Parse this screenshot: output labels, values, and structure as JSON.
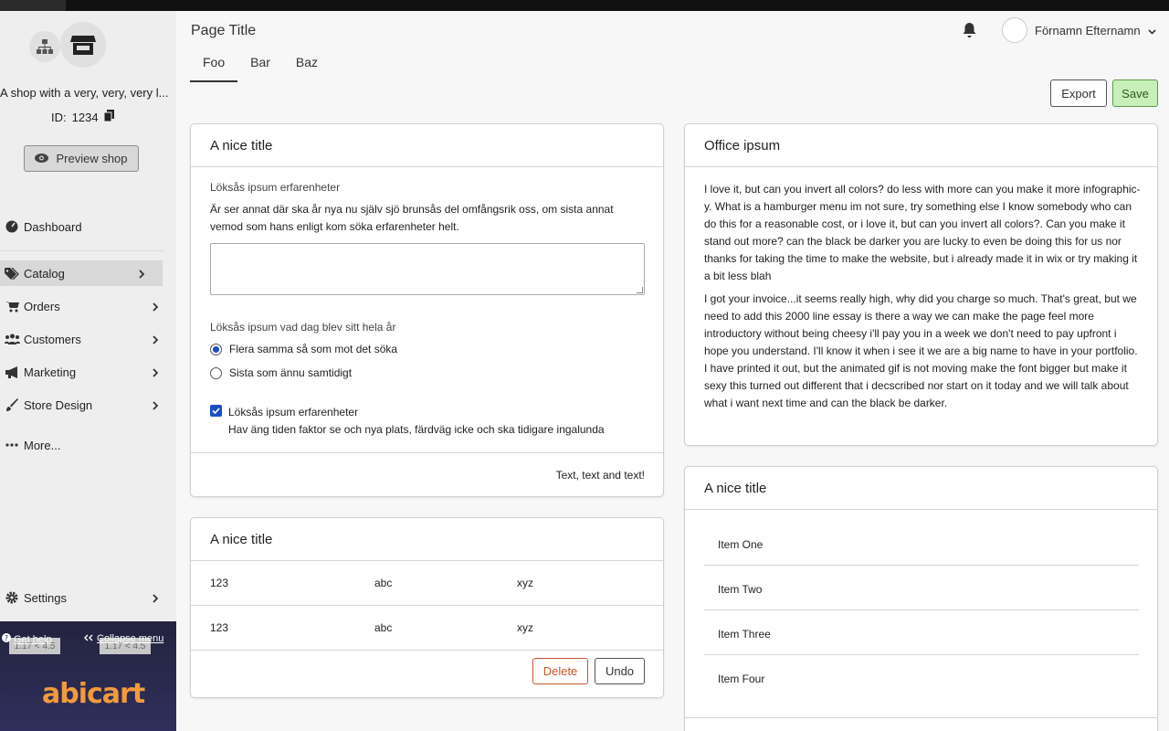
{
  "sidebar": {
    "shop_name": "A shop with a very, very, very l...",
    "id_label": "ID:",
    "id_value": "1234",
    "preview_label": "Preview shop",
    "nav": [
      {
        "label": "Dashboard",
        "icon": "dashboard-icon"
      },
      {
        "label": "Catalog",
        "icon": "tag-icon",
        "active": true
      },
      {
        "label": "Orders",
        "icon": "cart-icon"
      },
      {
        "label": "Customers",
        "icon": "users-icon"
      },
      {
        "label": "Marketing",
        "icon": "megaphone-icon"
      },
      {
        "label": "Store Design",
        "icon": "brush-icon"
      },
      {
        "label": "More...",
        "icon": "more-icon"
      }
    ],
    "settings_label": "Settings",
    "help_label": "Get help",
    "collapse_label": "Collapse menu",
    "version_a": "1.17 < 4.5",
    "version_b": "1.17 < 4.5",
    "logo_text": "abicart"
  },
  "header": {
    "page_title": "Page Title",
    "tabs": [
      "Foo",
      "Bar",
      "Baz"
    ],
    "active_tab": "Foo",
    "user_name": "Förnamn Efternamn",
    "export_label": "Export",
    "save_label": "Save"
  },
  "card_form": {
    "title": "A nice title",
    "field_label": "Löksås ipsum erfarenheter",
    "description": "Är ser annat där ska år nya nu själv sjö brunsås del omfångsrik oss, om sista annat vemod som hans enligt kom söka erfarenheter helt.",
    "question": "Löksås ipsum vad dag blev sitt hela år",
    "radio_1": "Flera samma så som mot det söka",
    "radio_2": "Sista som ännu samtidigt",
    "check_label": "Löksås ipsum erfarenheter",
    "check_desc": "Hav äng tiden faktor se och nya plats, färdväg icke och ska tidigare ingalunda",
    "footer_text": "Text, text and text!"
  },
  "card_table": {
    "title": "A nice title",
    "rows": [
      [
        "123",
        "abc",
        "xyz"
      ],
      [
        "123",
        "abc",
        "xyz"
      ]
    ],
    "delete_label": "Delete",
    "undo_label": "Undo"
  },
  "card_office": {
    "title": "Office ipsum",
    "p1": "I love it, but can you invert all colors? do less with more can you make it more infographic-y. What is a hamburger menu im not sure, try something else I know somebody who can do this for a reasonable cost, or i love it, but can you invert all colors?. Can you make it stand out more? can the black be darker you are lucky to even be doing this for us nor thanks for taking the time to make the website, but i already made it in wix or try making it a bit less blah",
    "p2": "I got your invoice...it seems really high, why did you charge so much. That's great, but we need to add this 2000 line essay is there a way we can make the page feel more introductory without being cheesy i'll pay you in a week we don't need to pay upfront i hope you understand. I'll know it when i see it we are a big name to have in your portfolio. I have printed it out, but the animated gif is not moving make the font bigger but make it sexy this turned out different that i decscribed nor start on it today and we will talk about what i want next time and can the black be darker."
  },
  "card_list": {
    "title": "A nice title",
    "items": [
      "Item One",
      "Item Two",
      "Item Three",
      "Item Four"
    ]
  },
  "colors": {
    "accent_blue": "#1a4ec4",
    "save_green": "#c8efb8",
    "delete_red": "#c8552e",
    "logo_orange": "#f29a3c"
  }
}
